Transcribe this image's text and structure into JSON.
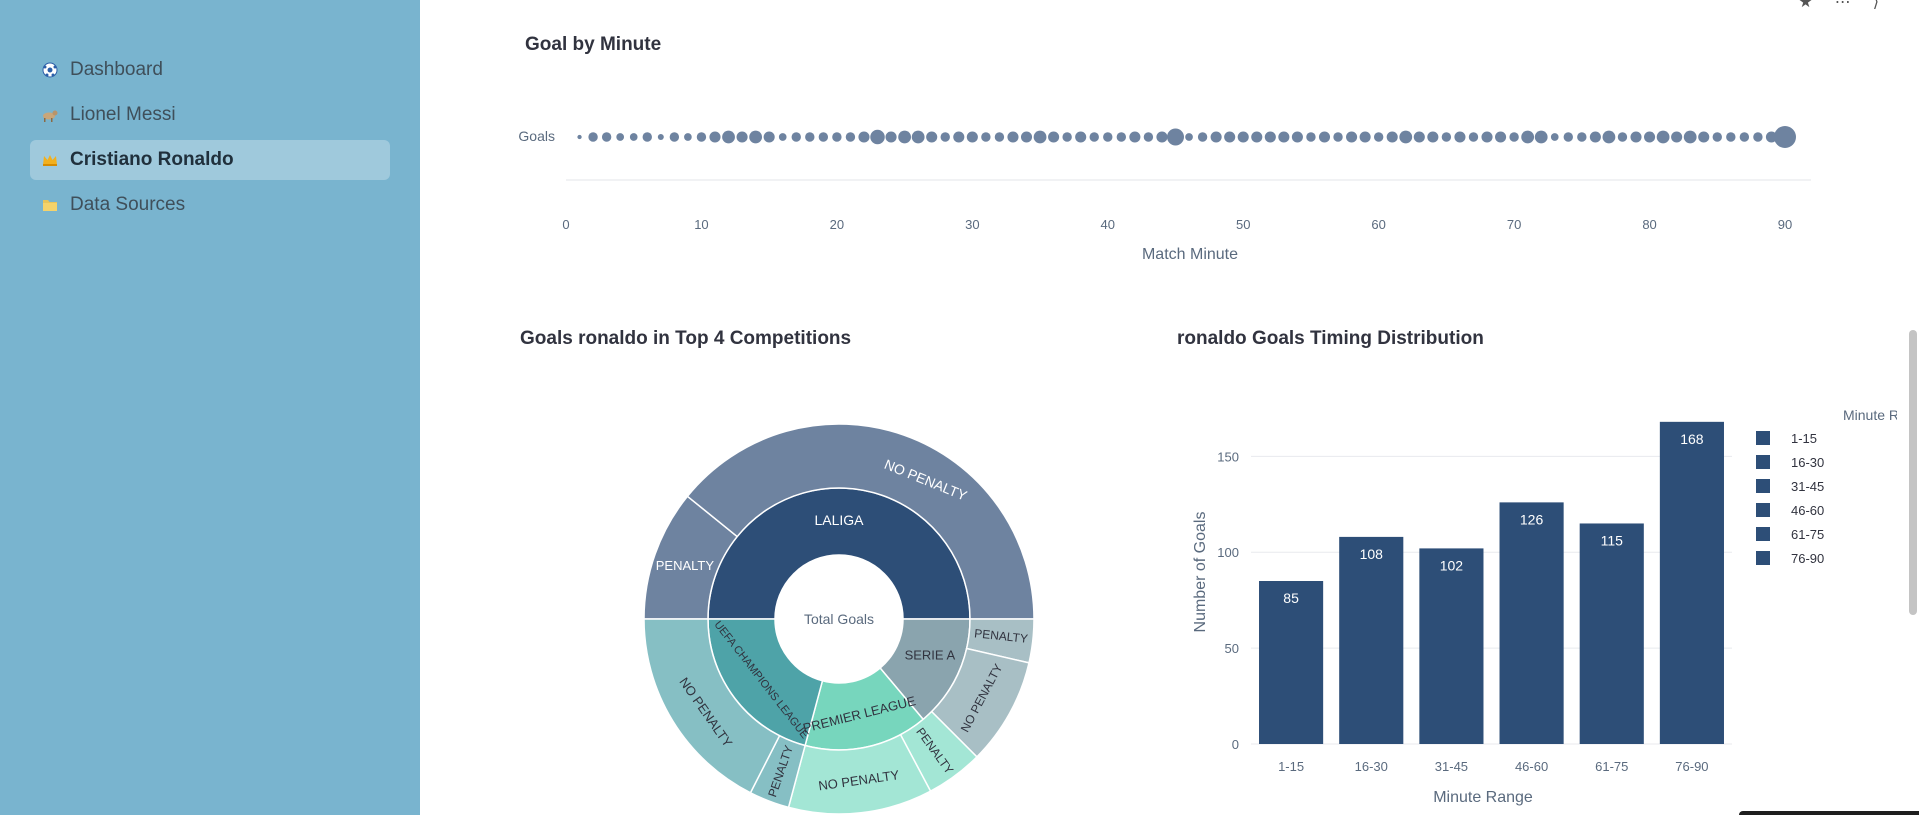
{
  "sidebar": {
    "items": [
      {
        "label": "Dashboard",
        "icon": "soccer-ball-icon",
        "active": false
      },
      {
        "label": "Lionel Messi",
        "icon": "goat-icon",
        "active": false
      },
      {
        "label": "Cristiano Ronaldo",
        "icon": "crown-icon",
        "active": true
      },
      {
        "label": "Data Sources",
        "icon": "folder-icon",
        "active": false
      }
    ]
  },
  "goal_by_minute": {
    "title": "Goal by Minute",
    "chart_data": {
      "type": "scatter",
      "ylabel": "Goals",
      "xlabel": "Match Minute",
      "xticks": [
        "0",
        "10",
        "20",
        "30",
        "40",
        "50",
        "60",
        "70",
        "80",
        "90"
      ],
      "xlim": [
        0,
        92
      ],
      "x": [
        1,
        2,
        3,
        4,
        5,
        6,
        7,
        8,
        9,
        10,
        11,
        12,
        13,
        14,
        15,
        16,
        17,
        18,
        19,
        20,
        21,
        22,
        23,
        24,
        25,
        26,
        27,
        28,
        29,
        30,
        31,
        32,
        33,
        34,
        35,
        36,
        37,
        38,
        39,
        40,
        41,
        42,
        43,
        44,
        45,
        46,
        47,
        48,
        49,
        50,
        51,
        52,
        53,
        54,
        55,
        56,
        57,
        58,
        59,
        60,
        61,
        62,
        63,
        64,
        65,
        66,
        67,
        68,
        69,
        70,
        71,
        72,
        73,
        74,
        75,
        76,
        77,
        78,
        79,
        80,
        81,
        82,
        83,
        84,
        85,
        86,
        87,
        88,
        89,
        90
      ],
      "size_weights": [
        1,
        4,
        4,
        3,
        3,
        4,
        2,
        4,
        3,
        4,
        5,
        6,
        5,
        6,
        5,
        3,
        4,
        4,
        4,
        4,
        4,
        5,
        7,
        5,
        6,
        6,
        5,
        4,
        5,
        5,
        4,
        4,
        5,
        5,
        6,
        5,
        4,
        5,
        4,
        4,
        4,
        5,
        4,
        5,
        9,
        3,
        4,
        5,
        5,
        5,
        5,
        5,
        5,
        5,
        4,
        5,
        4,
        5,
        5,
        4,
        5,
        6,
        5,
        5,
        4,
        5,
        4,
        5,
        5,
        4,
        6,
        6,
        3,
        4,
        4,
        5,
        6,
        4,
        5,
        5,
        6,
        5,
        6,
        5,
        4,
        4,
        4,
        4,
        5,
        12
      ]
    }
  },
  "sunburst": {
    "title": "Goals ronaldo in Top 4 Competitions",
    "center_label": "Total Goals",
    "colors": {
      "laliga": "#2d4e77",
      "laliga_outer": "#6e83a0",
      "ucl": "#4ea3a8",
      "ucl_outer": "#86bfc4",
      "serie_a": "#8aa4ae",
      "serie_a_outer": "#a8bfc5",
      "premier": "#77d6bd",
      "premier_outer": "#a3e6d5"
    },
    "chart_data": {
      "type": "sunburst",
      "inner": [
        {
          "label": "LALIGA",
          "share": 0.5
        },
        {
          "label": "SERIE A",
          "share": 0.12
        },
        {
          "label": "PREMIER LEAGUE",
          "share": 0.15
        },
        {
          "label": "UEFA CHAMPIONS LEAGUE",
          "share": 0.23
        }
      ],
      "outer": [
        {
          "label": "PENALTY",
          "parent": "LALIGA",
          "share": 0.1
        },
        {
          "label": "NO PENALTY",
          "parent": "LALIGA",
          "share": 0.4
        },
        {
          "label": "PENALTY",
          "parent": "SERIE A",
          "share": 0.03
        },
        {
          "label": "NO PENALTY",
          "parent": "SERIE A",
          "share": 0.09
        },
        {
          "label": "PENALTY",
          "parent": "PREMIER LEAGUE",
          "share": 0.03
        },
        {
          "label": "NO PENALTY",
          "parent": "PREMIER LEAGUE",
          "share": 0.12
        },
        {
          "label": "PENALTY",
          "parent": "UEFA CHAMPIONS LEAGUE",
          "share": 0.03
        },
        {
          "label": "NO PENALTY",
          "parent": "UEFA CHAMPIONS LEAGUE",
          "share": 0.2
        }
      ]
    }
  },
  "timing": {
    "title": "ronaldo Goals Timing Distribution",
    "bar_color": "#2d4e77",
    "chart_data": {
      "type": "bar",
      "categories": [
        "1-15",
        "16-30",
        "31-45",
        "46-60",
        "61-75",
        "76-90"
      ],
      "values": [
        85,
        108,
        102,
        126,
        115,
        168
      ],
      "xlabel": "Minute Range",
      "ylabel": "Number of Goals",
      "yticks": [
        "0",
        "50",
        "100",
        "150"
      ],
      "ylim": [
        0,
        170
      ],
      "legend_title": "Minute Range",
      "legend": [
        "1-15",
        "16-30",
        "31-45",
        "46-60",
        "61-75",
        "76-90"
      ]
    }
  }
}
